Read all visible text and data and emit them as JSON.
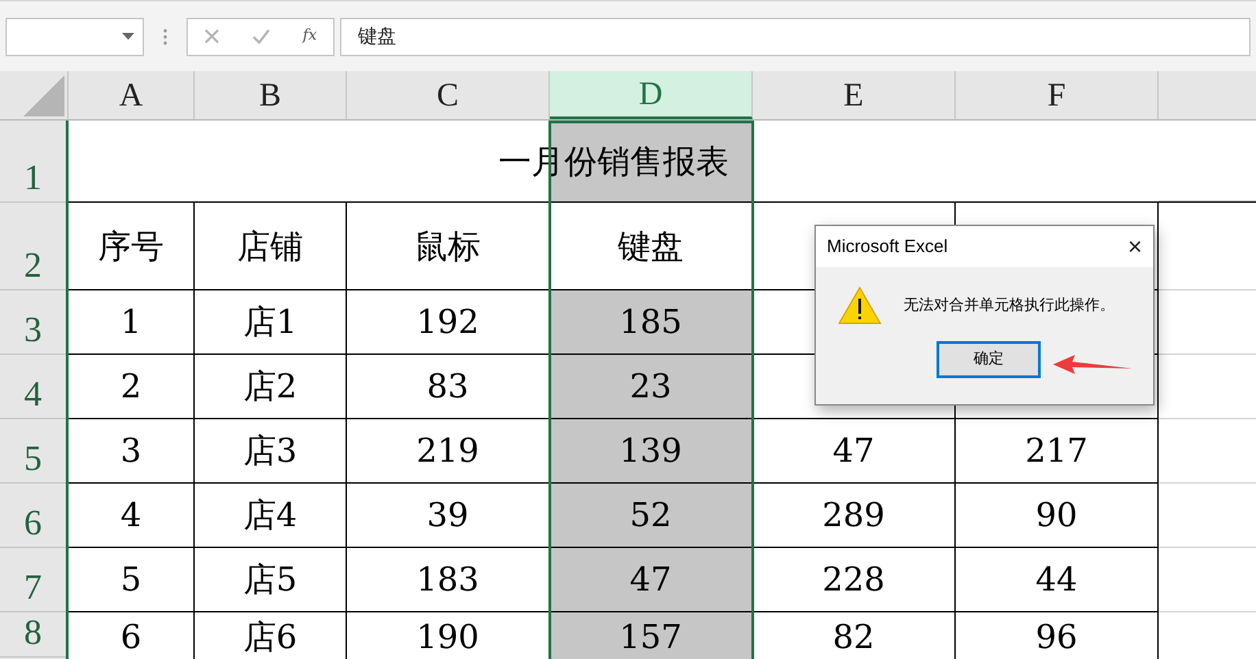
{
  "formula_bar": {
    "fx": "fx",
    "value": "键盘"
  },
  "columns": [
    {
      "label": "A",
      "selected": false
    },
    {
      "label": "B",
      "selected": false
    },
    {
      "label": "C",
      "selected": false
    },
    {
      "label": "D",
      "selected": true
    },
    {
      "label": "E",
      "selected": false
    },
    {
      "label": "F",
      "selected": false
    }
  ],
  "title_row": {
    "number": "1",
    "text": "一月份销售报表"
  },
  "rows": [
    {
      "number": "2",
      "active": true,
      "cells": [
        "序号",
        "店铺",
        "鼠标",
        "键盘",
        null,
        null
      ]
    },
    {
      "number": "3",
      "active": false,
      "cells": [
        "1",
        "店1",
        "192",
        "185",
        null,
        null
      ]
    },
    {
      "number": "4",
      "active": false,
      "cells": [
        "2",
        "店2",
        "83",
        "23",
        null,
        null
      ]
    },
    {
      "number": "5",
      "active": false,
      "cells": [
        "3",
        "店3",
        "219",
        "139",
        "47",
        "217"
      ]
    },
    {
      "number": "6",
      "active": false,
      "cells": [
        "4",
        "店4",
        "39",
        "52",
        "289",
        "90"
      ]
    },
    {
      "number": "7",
      "active": false,
      "cells": [
        "5",
        "店5",
        "183",
        "47",
        "228",
        "44"
      ]
    },
    {
      "number": "8",
      "active": false,
      "cells": [
        "6",
        "店6",
        "190",
        "157",
        "82",
        "96"
      ]
    }
  ],
  "dialog": {
    "title": "Microsoft Excel",
    "close": "×",
    "message": "无法对合并单元格执行此操作。",
    "button": {
      "label": "确定",
      "selected": true
    }
  }
}
